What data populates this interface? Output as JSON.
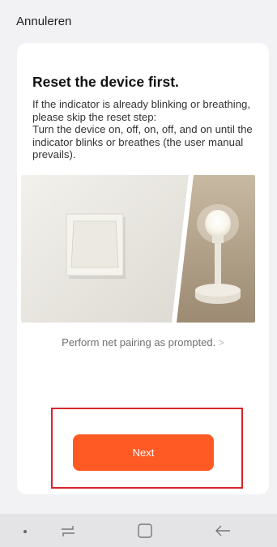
{
  "header": {
    "cancel_label": "Annuleren"
  },
  "content": {
    "title": "Reset the device first.",
    "description": "If the indicator is already blinking or breathing, please skip the reset step:\nTurn the device on, off, on, off, and on until the indicator blinks or breathes (the user manual prevails).",
    "pairing_link_label": "Perform net pairing as prompted.",
    "pairing_link_chevron": ">"
  },
  "footer": {
    "next_label": "Next"
  },
  "navbar": {
    "icons": [
      "dot-icon",
      "recent-apps-icon",
      "home-icon",
      "back-icon"
    ]
  },
  "colors": {
    "accent": "#ff5a24",
    "highlight": "#d9252a",
    "background": "#f2f2f4",
    "card": "#ffffff"
  }
}
